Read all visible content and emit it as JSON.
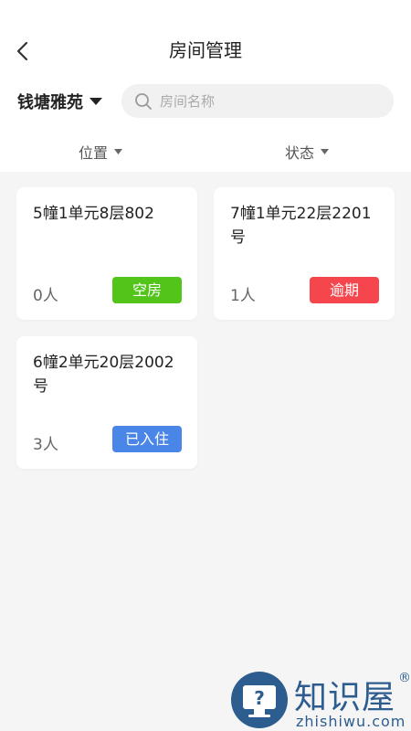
{
  "header": {
    "title": "房间管理",
    "back_icon": "chevron-left-icon"
  },
  "community": {
    "name": "钱塘雅苑",
    "caret_icon": "caret-down-icon"
  },
  "search": {
    "placeholder": "房间名称",
    "value": "",
    "icon": "search-icon"
  },
  "filters": {
    "location_label": "位置",
    "status_label": "状态"
  },
  "rooms": [
    {
      "title": "5幢1单元8层802",
      "count": "0人",
      "status": "空房",
      "status_color": "#52c41a"
    },
    {
      "title": "7幢1单元22层2201号",
      "count": "1人",
      "status": "逾期",
      "status_color": "#f5464d"
    },
    {
      "title": "6幢2单元20层2002号",
      "count": "3人",
      "status": "已入住",
      "status_color": "#4a86e8"
    }
  ],
  "watermark": {
    "cn": "知识屋",
    "en": "zhishiwu.com",
    "reg": "®"
  },
  "colors": {
    "background": "#f5f5f5",
    "card": "#ffffff",
    "watermark": "#2d5d8e"
  }
}
